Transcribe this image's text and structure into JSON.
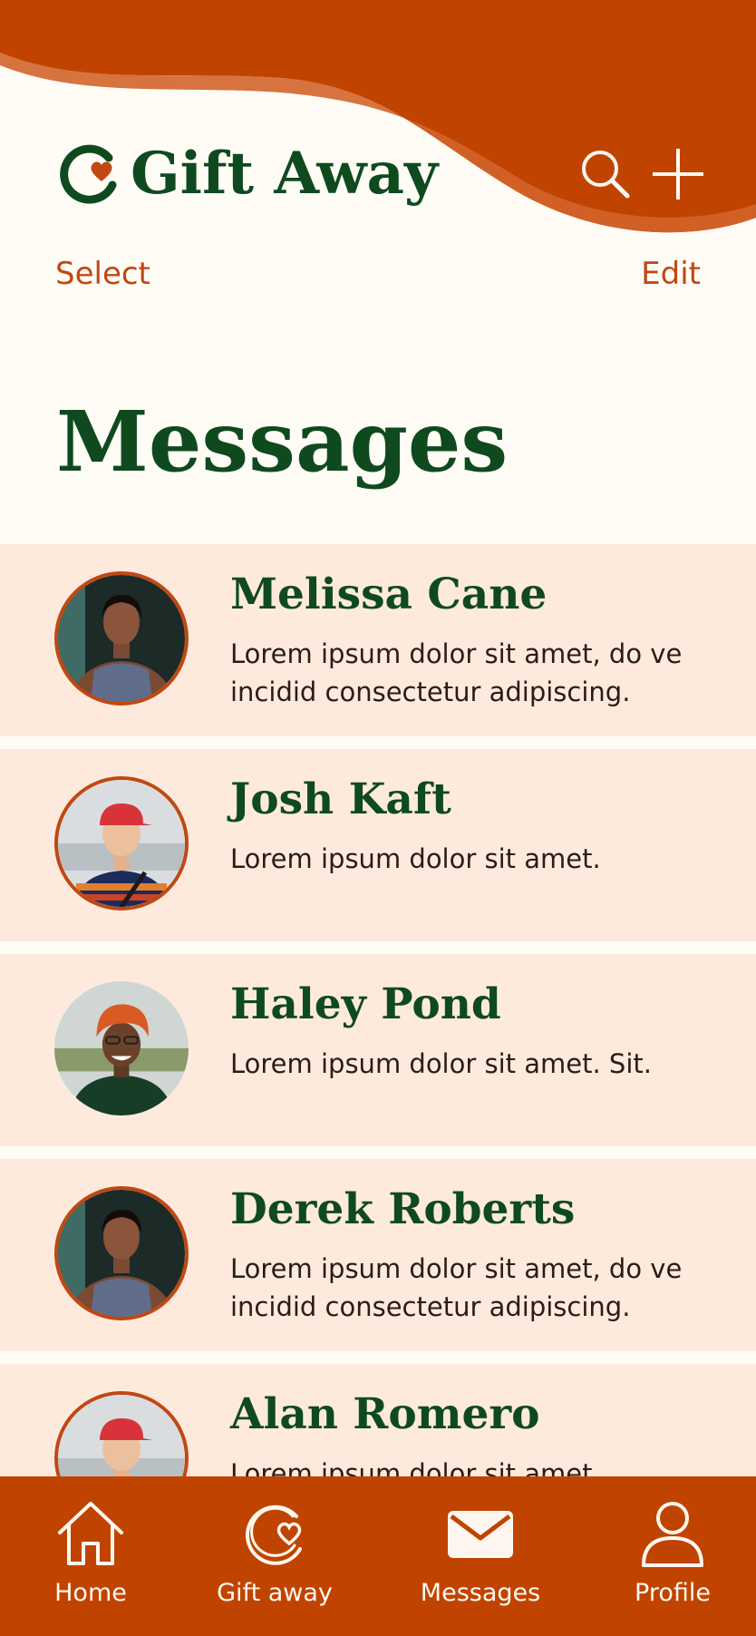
{
  "colors": {
    "brand_orange": "#c04400",
    "brand_green": "#0f4a1f",
    "background": "#fffcf6",
    "row_background": "#fdeadd",
    "link": "#c04812"
  },
  "header": {
    "app_name": "Gift Away",
    "logo_icon": "gift-away-logo-icon",
    "search_icon": "search-icon",
    "add_icon": "plus-icon",
    "select_label": "Select",
    "edit_label": "Edit"
  },
  "page": {
    "title": "Messages"
  },
  "conversations": [
    {
      "name": "Melissa Cane",
      "preview": "Lorem ipsum dolor sit amet, do ve incidid consectetur adipiscing."
    },
    {
      "name": "Josh Kaft",
      "preview": "Lorem ipsum dolor sit amet."
    },
    {
      "name": "Haley Pond",
      "preview": "Lorem ipsum dolor sit amet. Sit."
    },
    {
      "name": "Derek Roberts",
      "preview": "Lorem ipsum dolor sit amet, do ve incidid consectetur adipiscing."
    },
    {
      "name": "Alan Romero",
      "preview": "Lorem ipsum dolor sit amet."
    }
  ],
  "tabbar": {
    "tabs": [
      {
        "label": "Home",
        "icon": "home-icon"
      },
      {
        "label": "Gift away",
        "icon": "gift-away-icon"
      },
      {
        "label": "Messages",
        "icon": "envelope-icon"
      },
      {
        "label": "Profile",
        "icon": "person-icon"
      }
    ]
  }
}
